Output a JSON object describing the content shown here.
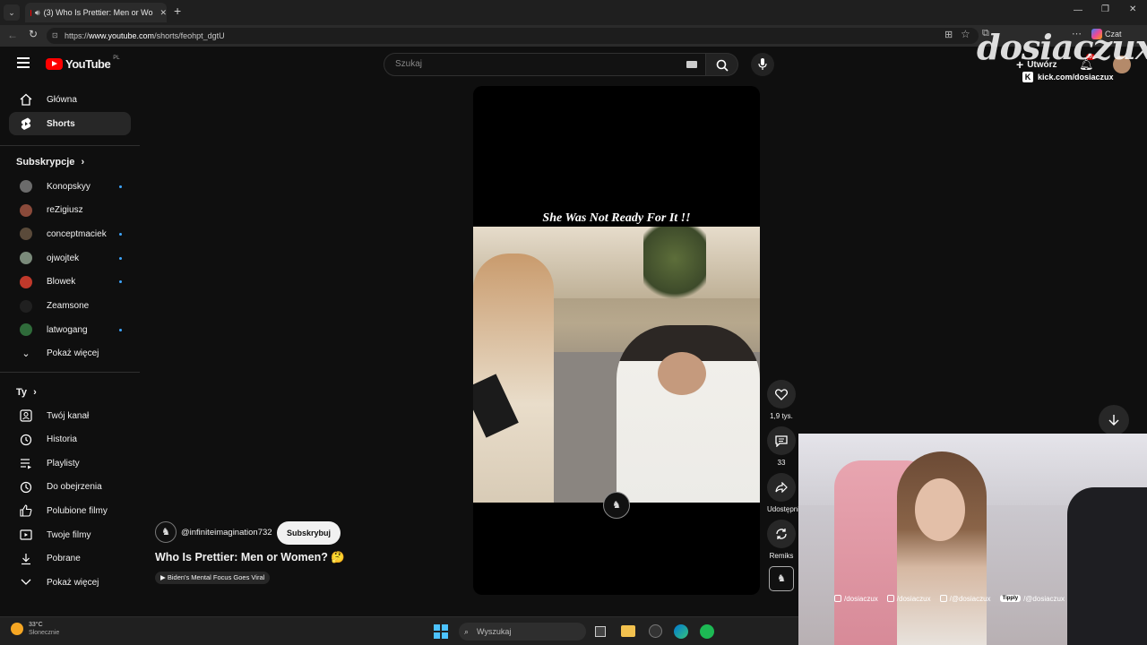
{
  "browser": {
    "tab_title": "(3) Who Is Prettier: Men or Wo",
    "url_prefix": "https://",
    "url_domain": "www.youtube.com",
    "url_path": "/shorts/feohpt_dgtU",
    "copilot_label": "Czat"
  },
  "youtube": {
    "logo_text": "YouTube",
    "logo_region": "PL",
    "search_placeholder": "Szukaj",
    "create_label": "Utwórz",
    "notification_count": "9"
  },
  "sidebar": {
    "main": [
      {
        "label": "Główna",
        "icon": "home-icon"
      },
      {
        "label": "Shorts",
        "icon": "shorts-icon"
      }
    ],
    "subscriptions_title": "Subskrypcje",
    "subscriptions": [
      {
        "label": "Konopskyy",
        "new": true,
        "color": "#6b6b6b"
      },
      {
        "label": "reZigiusz",
        "new": false,
        "color": "#8a4a3a"
      },
      {
        "label": "conceptmaciek",
        "new": true,
        "color": "#5a4a3a"
      },
      {
        "label": "ojwojtek",
        "new": true,
        "color": "#7a8a7a"
      },
      {
        "label": "Blowek",
        "new": true,
        "color": "#c0392b"
      },
      {
        "label": "Zeamsone",
        "new": false,
        "color": "#202020"
      },
      {
        "label": "latwogang",
        "new": true,
        "color": "#2f6b3a"
      }
    ],
    "show_more": "Pokaż więcej",
    "you_title": "Ty",
    "you_items": [
      {
        "label": "Twój kanał",
        "icon": "channel-icon"
      },
      {
        "label": "Historia",
        "icon": "history-icon"
      },
      {
        "label": "Playlisty",
        "icon": "playlist-icon"
      },
      {
        "label": "Do obejrzenia",
        "icon": "clock-icon"
      },
      {
        "label": "Polubione filmy",
        "icon": "thumb-up-icon"
      },
      {
        "label": "Twoje filmy",
        "icon": "video-icon"
      },
      {
        "label": "Pobrane",
        "icon": "download-icon"
      },
      {
        "label": "Pokaż więcej",
        "icon": "chevron-down-icon"
      }
    ]
  },
  "short": {
    "caption": "She Was Not Ready For It !!",
    "channel": "@infiniteimagination732",
    "subscribe_label": "Subskrybuj",
    "title": "Who Is Prettier: Men or Women? 🤔",
    "related_label": "▶ Biden's Mental Focus Goes Viral",
    "likes": "1,9 tys.",
    "comments": "33",
    "share_label": "Udostępnij",
    "remix_label": "Remiks"
  },
  "overlay": {
    "brand": "dosiaczux",
    "kick_url": "kick.com/dosiaczux",
    "socials": [
      "/dosiaczux",
      "/dosiaczux",
      "/@dosiaczux",
      "/@dosiaczux"
    ],
    "tipply_label": "Tipply"
  },
  "taskbar": {
    "temperature": "33°C",
    "weather": "Słonecznie",
    "search_placeholder": "Wyszukaj"
  },
  "colors": {
    "accent_red": "#ff0000",
    "blue_dot": "#3ea6ff",
    "background": "#0f0f0f"
  }
}
